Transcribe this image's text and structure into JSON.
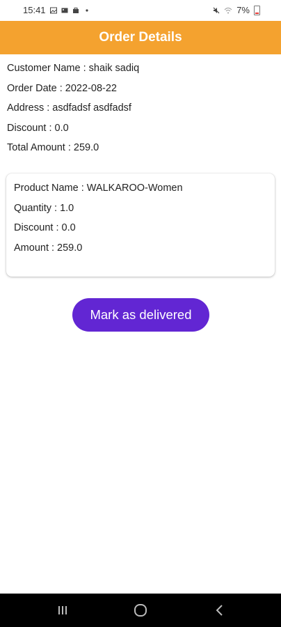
{
  "status_bar": {
    "time": "15:41",
    "battery": "7%",
    "left_icons": [
      "gallery-icon",
      "image-icon",
      "bag-icon",
      "dot-icon"
    ],
    "right_icons": [
      "mute-icon",
      "wifi-icon",
      "battery-icon"
    ]
  },
  "app_bar": {
    "title": "Order Details"
  },
  "order": {
    "customer": "Customer Name : shaik sadiq",
    "date": "Order Date : 2022-08-22",
    "address": "Address : asdfadsf asdfadsf",
    "discount": "Discount : 0.0",
    "total": "Total Amount : 259.0"
  },
  "product": {
    "name": "Product Name : WALKAROO-Women",
    "quantity": "Quantity : 1.0",
    "discount": "Discount : 0.0",
    "amount": "Amount : 259.0"
  },
  "actions": {
    "deliver_label": "Mark as delivered"
  },
  "colors": {
    "app_bar": "#f4a22f",
    "button": "#6226d3"
  },
  "nav_bar": {
    "buttons": [
      "recent-apps-icon",
      "home-icon",
      "back-icon"
    ]
  }
}
